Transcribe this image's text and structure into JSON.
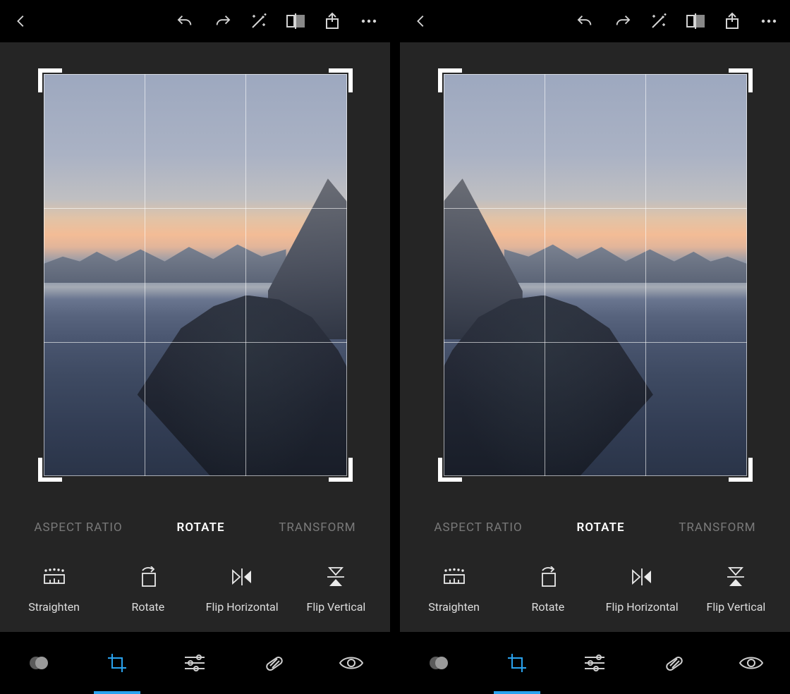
{
  "subtabs": {
    "aspect_ratio": "ASPECT RATIO",
    "rotate": "ROTATE",
    "transform": "TRANSFORM",
    "active": "rotate"
  },
  "tools": {
    "straighten": "Straighten",
    "rotate": "Rotate",
    "flip_horizontal": "Flip Horizontal",
    "flip_vertical": "Flip Vertical"
  },
  "icons": {
    "back": "back",
    "undo": "undo",
    "redo": "redo",
    "auto": "auto-enhance",
    "compare": "compare",
    "share": "share",
    "more": "more",
    "layers": "layers",
    "crop": "crop",
    "sliders": "adjust",
    "spot": "spot-heal",
    "redeye": "red-eye"
  },
  "bottom_active": "crop",
  "panes": [
    {
      "flipped": false
    },
    {
      "flipped": true
    }
  ]
}
